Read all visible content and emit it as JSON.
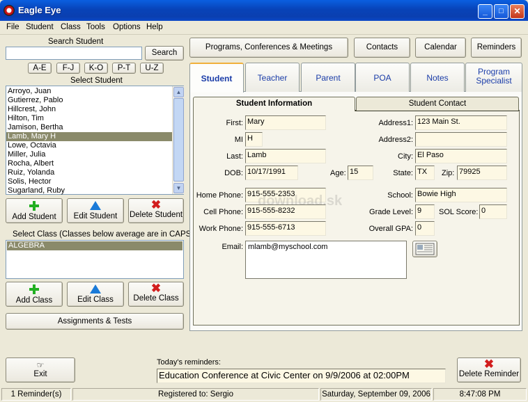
{
  "window": {
    "title": "Eagle Eye",
    "minimize": "_",
    "maximize": "□",
    "close": "✕"
  },
  "menu": [
    "File",
    "Student",
    "Class",
    "Tools",
    "Options",
    "Help"
  ],
  "search": {
    "label": "Search Student",
    "value": "",
    "button": "Search"
  },
  "alpha": [
    "A-E",
    "F-J",
    "K-O",
    "P-T",
    "U-Z"
  ],
  "student_list": {
    "label": "Select Student",
    "items": [
      "Arroyo, Juan",
      "Gutierrez, Pablo",
      "Hillcrest, John",
      "Hilton, Tim",
      "Jamison, Bertha",
      "Lamb, Mary H",
      "Lowe, Octavia",
      "Miller, Julia",
      "Rocha, Albert",
      "Ruiz, Yolanda",
      "Solis, Hector",
      "Sugarland, Ruby"
    ],
    "selected": 5
  },
  "student_buttons": {
    "add": "Add Student",
    "edit": "Edit Student",
    "delete": "Delete Student"
  },
  "class_list": {
    "label": "Select Class (Classes below average are in CAPS)",
    "items": [
      "ALGEBRA"
    ]
  },
  "class_buttons": {
    "add": "Add Class",
    "edit": "Edit Class",
    "delete": "Delete Class"
  },
  "assignments_button": "Assignments & Tests",
  "top_buttons": {
    "programs": "Programs, Conferences & Meetings",
    "contacts": "Contacts",
    "calendar": "Calendar",
    "reminders": "Reminders"
  },
  "tabs": [
    "Student",
    "Teacher",
    "Parent",
    "POA",
    "Notes",
    "Program Specialist"
  ],
  "subtabs": {
    "info": "Student Information",
    "contact": "Student Contact"
  },
  "student": {
    "first_label": "First:",
    "first": "Mary",
    "mi_label": "MI",
    "mi": "H",
    "last_label": "Last:",
    "last": "Lamb",
    "dob_label": "DOB:",
    "dob": "10/17/1991",
    "age_label": "Age:",
    "age": "15",
    "address1_label": "Address1:",
    "address1": "123 Main St.",
    "address2_label": "Address2:",
    "address2": "",
    "city_label": "City:",
    "city": "El Paso",
    "state_label": "State:",
    "state": "TX",
    "zip_label": "Zip:",
    "zip": "79925",
    "home_phone_label": "Home Phone:",
    "home_phone": "915-555-2353",
    "cell_phone_label": "Cell Phone:",
    "cell_phone": "915-555-8232",
    "work_phone_label": "Work Phone:",
    "work_phone": "915-555-6713",
    "school_label": "School:",
    "school": "Bowie High",
    "grade_label": "Grade Level:",
    "grade": "9",
    "sol_label": "SOL Score:",
    "sol": "0",
    "gpa_label": "Overall GPA:",
    "gpa": "0",
    "email_label": "Email:",
    "email": "mlamb@myschool.com"
  },
  "watermark": "download.sk",
  "exit_button": "Exit",
  "reminders": {
    "label": "Today's reminders:",
    "text": "Education Conference at Civic Center on 9/9/2006 at 02:00PM",
    "delete": "Delete Reminder"
  },
  "status": {
    "count": "1 Reminder(s)",
    "registered": "Registered to: Sergio",
    "date": "Saturday, September 09, 2006",
    "time": "8:47:08 PM"
  }
}
